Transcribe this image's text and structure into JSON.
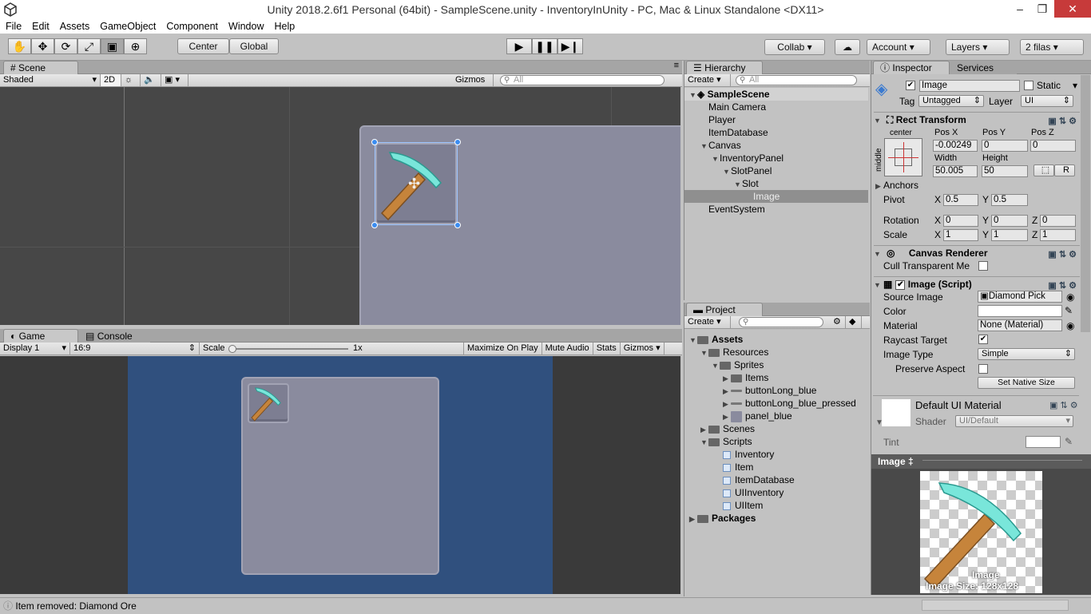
{
  "window": {
    "title": "Unity 2018.2.6f1 Personal (64bit) - SampleScene.unity - InventoryInUnity - PC, Mac & Linux Standalone <DX11>",
    "minimize": "–",
    "maximize": "❐",
    "close": "✕"
  },
  "menu": [
    "File",
    "Edit",
    "Assets",
    "GameObject",
    "Component",
    "Window",
    "Help"
  ],
  "toolbar": {
    "pivot": "Center",
    "space": "Global",
    "collab": "Collab ▾",
    "cloud": "☁",
    "account": "Account",
    "layers": "Layers",
    "layout": "2 filas"
  },
  "scene": {
    "tab": "Scene",
    "shading": "Shaded",
    "mode2d": "2D",
    "gizmos": "Gizmos",
    "search_placeholder": "All"
  },
  "game": {
    "tab": "Game",
    "console_tab": "Console",
    "display": "Display 1",
    "aspect": "16:9",
    "scale_label": "Scale",
    "scale_value": "1x",
    "maximize": "Maximize On Play",
    "mute": "Mute Audio",
    "stats": "Stats",
    "gizmos": "Gizmos"
  },
  "hierarchy": {
    "tab": "Hierarchy",
    "create": "Create",
    "search_placeholder": "All",
    "scene": "SampleScene",
    "items": [
      "Main Camera",
      "Player",
      "ItemDatabase",
      "Canvas",
      "InventoryPanel",
      "SlotPanel",
      "Slot",
      "Image",
      "EventSystem"
    ]
  },
  "project": {
    "tab": "Project",
    "create": "Create",
    "items": [
      "Assets",
      "Resources",
      "Sprites",
      "Items",
      "buttonLong_blue",
      "buttonLong_blue_pressed",
      "panel_blue",
      "Scenes",
      "Scripts",
      "Inventory",
      "Item",
      "ItemDatabase",
      "UIInventory",
      "UIItem",
      "Packages"
    ]
  },
  "inspector": {
    "tab": "Inspector",
    "services_tab": "Services",
    "object_name": "Image",
    "static_label": "Static",
    "tag_label": "Tag",
    "tag_value": "Untagged",
    "layer_label": "Layer",
    "layer_value": "UI",
    "rect": {
      "title": "Rect Transform",
      "anchor_h": "center",
      "anchor_v": "middle",
      "posx_label": "Pos X",
      "posy_label": "Pos Y",
      "posz_label": "Pos Z",
      "posx": "-0.00249",
      "posy": "0",
      "posz": "0",
      "width_label": "Width",
      "height_label": "Height",
      "width": "50.005",
      "height": "50",
      "r_button": "R",
      "anchors_label": "Anchors",
      "pivot_label": "Pivot",
      "pivot_x": "0.5",
      "pivot_y": "0.5",
      "rotation_label": "Rotation",
      "rot_x": "0",
      "rot_y": "0",
      "rot_z": "0",
      "scale_label": "Scale",
      "scale_x": "1",
      "scale_y": "1",
      "scale_z": "1",
      "x": "X",
      "y": "Y",
      "z": "Z"
    },
    "renderer": {
      "title": "Canvas Renderer",
      "cull_label": "Cull Transparent Me"
    },
    "image": {
      "title": "Image (Script)",
      "source_label": "Source Image",
      "source_value": "Diamond Pick",
      "color_label": "Color",
      "material_label": "Material",
      "material_value": "None (Material)",
      "raycast_label": "Raycast Target",
      "type_label": "Image Type",
      "type_value": "Simple",
      "preserve_label": "Preserve Aspect",
      "native_button": "Set Native Size"
    },
    "material": {
      "name": "Default UI Material",
      "shader_label": "Shader",
      "shader_value": "UI/Default",
      "tint_label": "Tint"
    },
    "preview": {
      "title": "Image ‡",
      "caption": "Image",
      "size": "Image Size: 128x128"
    }
  },
  "status": {
    "message": "Item removed: Diamond Ore"
  }
}
